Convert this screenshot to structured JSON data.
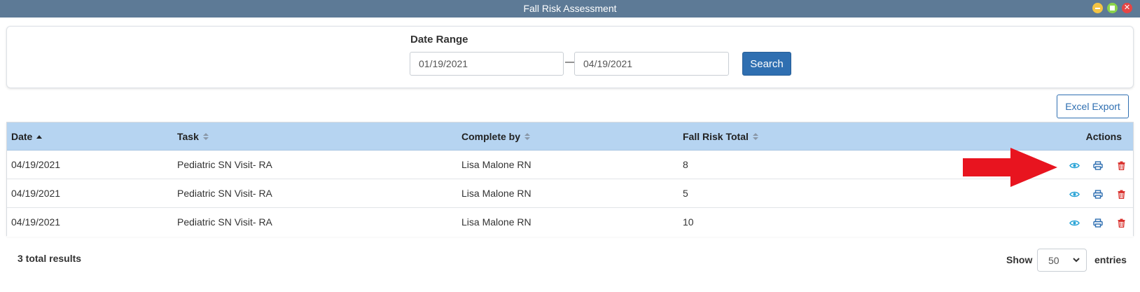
{
  "window": {
    "title": "Fall Risk Assessment",
    "controls": [
      "minimize",
      "maximize",
      "close"
    ]
  },
  "filter": {
    "label": "Date Range",
    "from_value": "01/19/2021",
    "to_value": "04/19/2021",
    "separator": "—",
    "search_label": "Search"
  },
  "toolbar": {
    "excel_export_label": "Excel Export"
  },
  "table": {
    "columns": [
      {
        "label": "Date",
        "sort": "ascending"
      },
      {
        "label": "Task",
        "sort": "none"
      },
      {
        "label": "Complete by",
        "sort": "none"
      },
      {
        "label": "Fall Risk Total",
        "sort": "none"
      },
      {
        "label": "Actions",
        "sort": null
      }
    ],
    "rows": [
      {
        "date": "04/19/2021",
        "task": "Pediatric SN Visit- RA",
        "complete_by": "Lisa Malone RN",
        "fall_risk_total": "8"
      },
      {
        "date": "04/19/2021",
        "task": "Pediatric SN Visit- RA",
        "complete_by": "Lisa Malone RN",
        "fall_risk_total": "5"
      },
      {
        "date": "04/19/2021",
        "task": "Pediatric SN Visit- RA",
        "complete_by": "Lisa Malone RN",
        "fall_risk_total": "10"
      }
    ],
    "row_actions": [
      "eye-icon",
      "print-icon",
      "trash-icon"
    ]
  },
  "footer": {
    "total_results": "3 total results",
    "show_label": "Show",
    "entries_value": "50",
    "entries_label": "entries"
  },
  "colors": {
    "titlebar": "#5d7a96",
    "primary": "#2f6fb1",
    "header_bg": "#b6d4f1",
    "view_icon": "#27a3d6",
    "delete_icon": "#d9302c",
    "annotation_arrow": "#e8141f"
  }
}
